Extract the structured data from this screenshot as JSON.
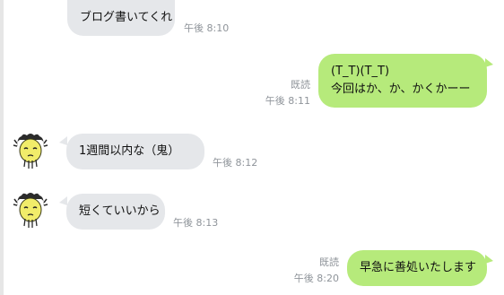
{
  "messages": [
    {
      "direction": "in",
      "text": "ブログ書いてくれ",
      "time": "午後 8:10",
      "avatar": false
    },
    {
      "direction": "out",
      "lines": [
        "(T_T)(T_T)",
        "今回はか、か、かくかーー"
      ],
      "read": "既読",
      "time": "午後 8:11"
    },
    {
      "direction": "in",
      "text": "1週間以内な（鬼）",
      "time": "午後 8:12",
      "avatar": true
    },
    {
      "direction": "in",
      "text": "短くていいから",
      "time": "午後 8:13",
      "avatar": true
    },
    {
      "direction": "out",
      "text": "早急に善処いたします",
      "read": "既読",
      "time": "午後 8:20"
    }
  ],
  "colors": {
    "incoming_bubble": "#e5e7ea",
    "outgoing_bubble": "#b6ea7b",
    "meta_text": "#8f949a"
  },
  "icons": {
    "avatar": "old-man-avatar-icon"
  }
}
